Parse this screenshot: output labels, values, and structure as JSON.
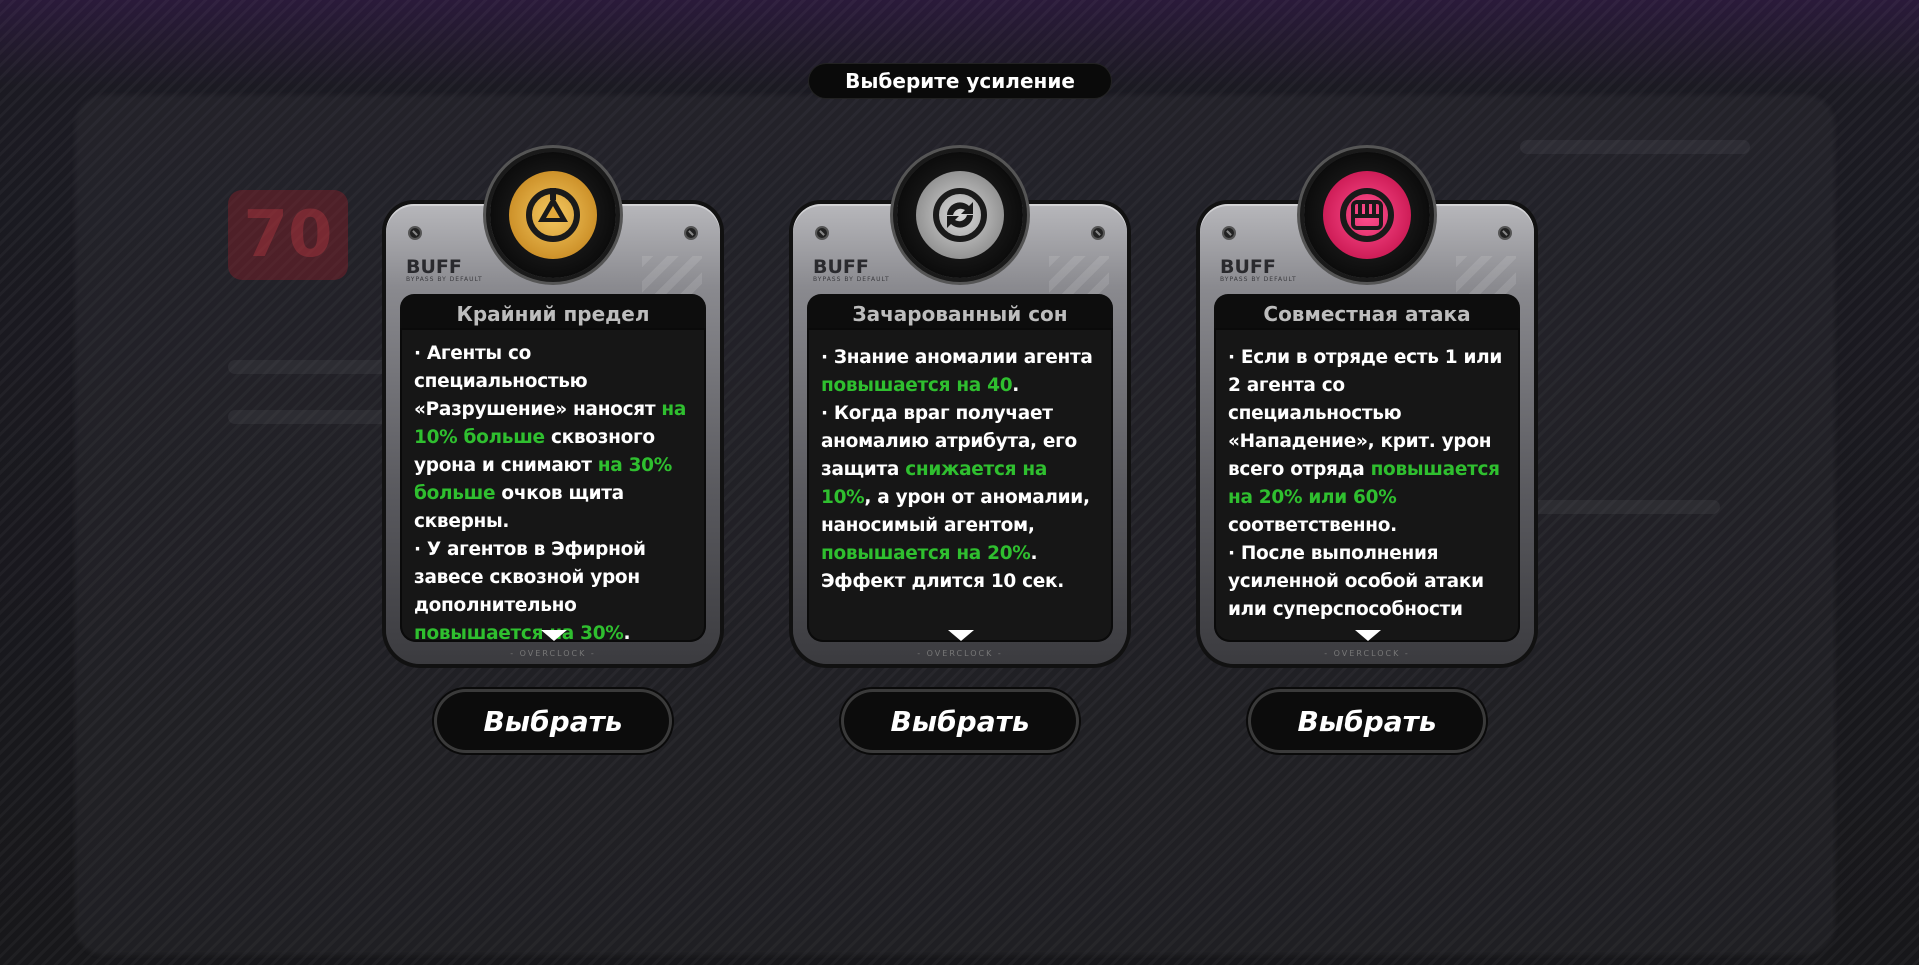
{
  "header": {
    "title": "Выберите усиление"
  },
  "cards": [
    {
      "tag": "BUFF",
      "tag_sub": "BYPASS BY DEFAULT",
      "title": "Крайний предел",
      "emblem_color": "#e4a93a",
      "icon": "buff-emblem-icon",
      "desc": [
        {
          "t": "· Агенты со специальностью «Разрушение» наносят "
        },
        {
          "t": "на 10% больше",
          "hl": true
        },
        {
          "t": " сквозного урона и снимают "
        },
        {
          "t": "на 30% больше",
          "hl": true
        },
        {
          "t": " очков щита скверны."
        },
        {
          "br": true
        },
        {
          "t": "· У агентов в Эфирной завесе сквозной урон дополнительно "
        },
        {
          "t": "повышается на 30%",
          "hl": true
        },
        {
          "t": "."
        }
      ],
      "footer": "- OVERCLOCK -",
      "button": "Выбрать"
    },
    {
      "tag": "BUFF",
      "tag_sub": "BYPASS BY DEFAULT",
      "title": "Зачарованный сон",
      "emblem_color": "#b5b5b5",
      "icon": "cycle-emblem-icon",
      "desc": [
        {
          "t": "· Знание аномалии агента "
        },
        {
          "t": "повышается на 40",
          "hl": true
        },
        {
          "t": "."
        },
        {
          "br": true
        },
        {
          "t": "· Когда враг получает аномалию атрибута, его защита "
        },
        {
          "t": "снижается на 10%",
          "hl": true
        },
        {
          "t": ", а урон от аномалии, наносимый агентом, "
        },
        {
          "t": "повышается на 20%",
          "hl": true
        },
        {
          "t": ". Эффект длится 10 сек."
        }
      ],
      "footer": "- OVERCLOCK -",
      "button": "Выбрать"
    },
    {
      "tag": "BUFF",
      "tag_sub": "BYPASS BY DEFAULT",
      "title": "Совместная атака",
      "emblem_color": "#e8286a",
      "icon": "fist-emblem-icon",
      "desc": [
        {
          "t": "· Если в отряде есть 1 или 2 агента со специальностью «Нападение», крит. урон всего отряда "
        },
        {
          "t": "повышается на 20% или 60%",
          "hl": true
        },
        {
          "t": " соответственно."
        },
        {
          "br": true
        },
        {
          "t": "· После выполнения усиленной особой атаки или суперспособности"
        }
      ],
      "footer": "- OVERCLOCK -",
      "button": "Выбрать"
    }
  ],
  "background": {
    "badge_text": "70"
  },
  "colors": {
    "highlight": "#2fbf2f",
    "accent_gold": "#e4a93a",
    "accent_silver": "#b5b5b5",
    "accent_pink": "#e8286a"
  }
}
